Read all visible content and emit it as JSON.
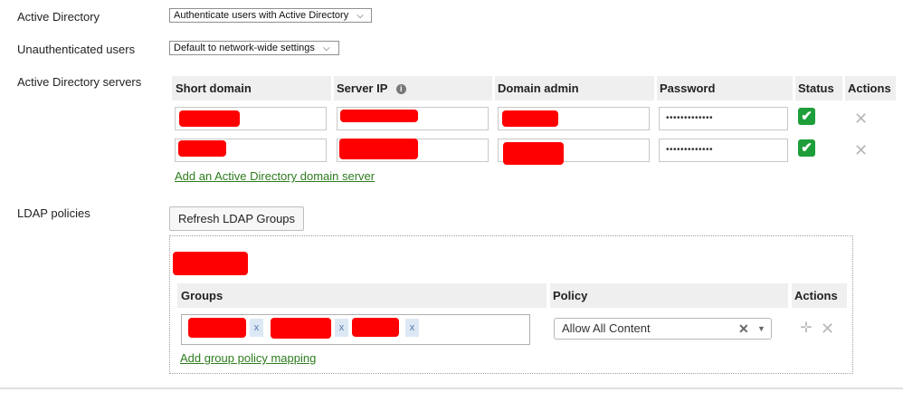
{
  "active_directory": {
    "label": "Active Directory",
    "selected": "Authenticate users with Active Directory"
  },
  "unauthenticated": {
    "label": "Unauthenticated users",
    "selected": "Default to network-wide settings"
  },
  "servers": {
    "label": "Active Directory servers",
    "headers": {
      "short_domain": "Short domain",
      "server_ip": "Server IP",
      "domain_admin": "Domain admin",
      "password": "Password",
      "status": "Status",
      "actions": "Actions"
    },
    "rows": [
      {
        "password": "•••••••••••••",
        "status": "ok"
      },
      {
        "password": "•••••••••••••",
        "status": "ok"
      }
    ],
    "add_link": "Add an Active Directory domain server"
  },
  "ldap": {
    "label": "LDAP policies",
    "refresh_button": "Refresh LDAP Groups",
    "headers": {
      "groups": "Groups",
      "policy": "Policy",
      "actions": "Actions"
    },
    "tag_remove": "x",
    "policy_value": "Allow All Content",
    "add_link": "Add group policy mapping"
  },
  "icons": {
    "remove": "close-icon",
    "status": "check-icon",
    "info": "info-icon",
    "move": "move-icon",
    "chevron": "chevron-down-icon"
  },
  "colors": {
    "link": "#2d7c1e",
    "status_ok": "#1d9e3a",
    "redaction": "#ff0000",
    "header_bg": "#efefef"
  }
}
